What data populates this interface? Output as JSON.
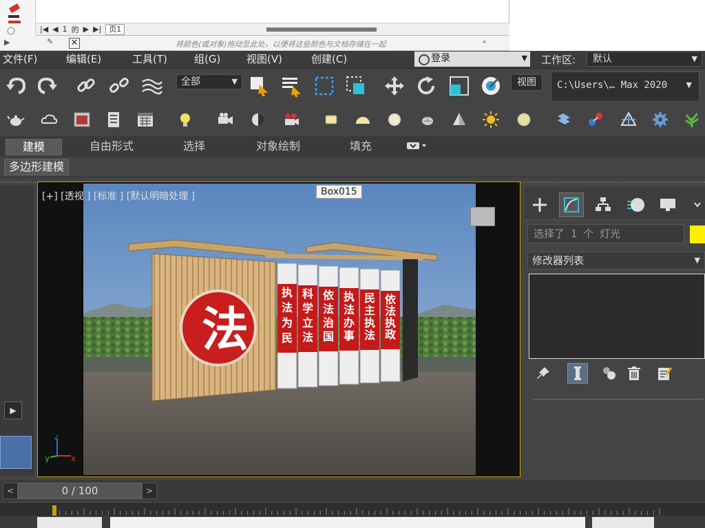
{
  "document": {
    "page_number": "1",
    "page_of": "的",
    "page_tab": "页1",
    "color_hint": "将颜色(或对象)拖动至此处，以便将这些颜色与文档存储在一起"
  },
  "menu": {
    "items": [
      "文件(F)",
      "编辑(E)",
      "工具(T)",
      "组(G)",
      "视图(V)",
      "创建(C)"
    ],
    "login": "登录",
    "workspace_label": "工作区:",
    "workspace_value": "默认"
  },
  "toolbar": {
    "selection_filter": "全部",
    "view_button": "视图",
    "project_path": "C:\\Users\\… Max 2020"
  },
  "ribbon": {
    "tabs": [
      "建模",
      "自由形式",
      "选择",
      "对象绘制",
      "填充"
    ],
    "active_tab": "建模",
    "sub_button": "多边形建模"
  },
  "viewport": {
    "label": "[+] [透视 ] [标准 ] [默认明暗处理 ]",
    "tooltip": "Box015",
    "emblem_char": "法",
    "panels": [
      "执法为民",
      "科学立法",
      "依法治国",
      "执法办事",
      "民主执法",
      "依法执政"
    ],
    "axis_x": "x",
    "axis_y": "y",
    "axis_z": "z"
  },
  "command_panel": {
    "selection_text": "选择了 1 个 灯光",
    "selection_color": "#ffee00",
    "modifier_list": "修改器列表"
  },
  "timeline": {
    "frame_display": "0 / 100"
  }
}
